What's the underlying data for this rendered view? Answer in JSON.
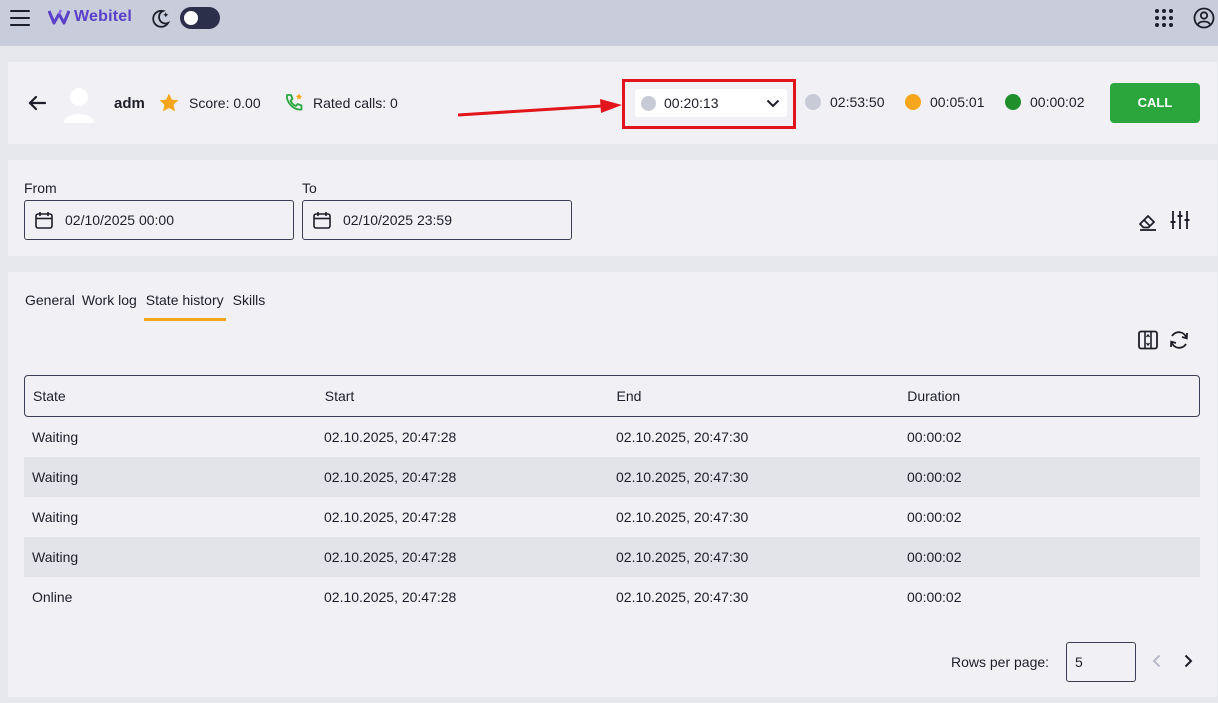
{
  "app": {
    "brand": "Webitel"
  },
  "agent": {
    "name": "adm",
    "score_label": "Score: 0.00",
    "rated_calls_label": "Rated calls: 0",
    "current_status_time": "00:20:13",
    "stats": [
      {
        "time": "02:53:50",
        "color": "#c8cad6"
      },
      {
        "time": "00:05:01",
        "color": "#f6a61a"
      },
      {
        "time": "00:00:02",
        "color": "#1e8f2b"
      }
    ],
    "call_button": "CALL"
  },
  "colors": {
    "highlight": "#e2151c",
    "active_tab": "#f6a61a",
    "call_button": "#2aa63c",
    "idle_status": "#c8cad6"
  },
  "filters": {
    "from_label": "From",
    "from_value": "02/10/2025 00:00",
    "to_label": "To",
    "to_value": "02/10/2025 23:59"
  },
  "tabs": [
    {
      "label": "General",
      "active": false
    },
    {
      "label": "Work log",
      "active": false
    },
    {
      "label": "State history",
      "active": true
    },
    {
      "label": "Skills",
      "active": false
    }
  ],
  "table": {
    "headers": [
      "State",
      "Start",
      "End",
      "Duration"
    ],
    "rows": [
      [
        "Waiting",
        "02.10.2025, 20:47:28",
        "02.10.2025, 20:47:30",
        "00:00:02"
      ],
      [
        "Waiting",
        "02.10.2025, 20:47:28",
        "02.10.2025, 20:47:30",
        "00:00:02"
      ],
      [
        "Waiting",
        "02.10.2025, 20:47:28",
        "02.10.2025, 20:47:30",
        "00:00:02"
      ],
      [
        "Waiting",
        "02.10.2025, 20:47:28",
        "02.10.2025, 20:47:30",
        "00:00:02"
      ],
      [
        "Online",
        "02.10.2025, 20:47:28",
        "02.10.2025, 20:47:30",
        "00:00:02"
      ]
    ]
  },
  "pagination": {
    "rows_per_page_label": "Rows per page:",
    "rows_per_page": "5"
  },
  "icons": [
    "menu-icon",
    "webitel-logo-icon",
    "moon-icon",
    "apps-icon",
    "account-icon",
    "back-arrow-icon",
    "avatar-icon",
    "star-icon",
    "phone-star-icon",
    "chevron-down-icon",
    "calendar-icon",
    "eraser-icon",
    "sliders-icon",
    "columns-icon",
    "refresh-icon",
    "chevron-left-icon",
    "chevron-right-icon"
  ]
}
